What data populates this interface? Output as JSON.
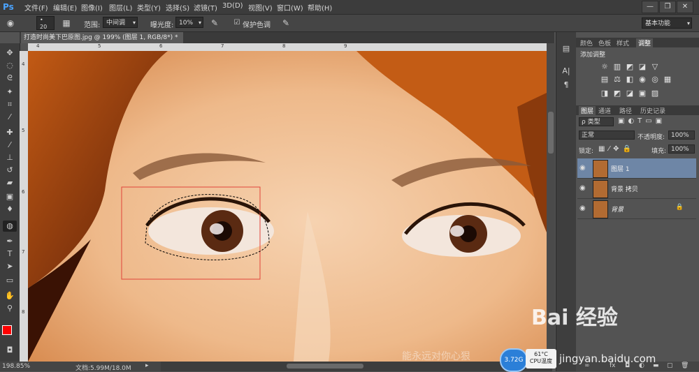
{
  "app": {
    "logo": "Ps"
  },
  "menu": [
    "文件(F)",
    "编辑(E)",
    "图像(I)",
    "图层(L)",
    "类型(Y)",
    "选择(S)",
    "滤镜(T)",
    "3D(D)",
    "视图(V)",
    "窗口(W)",
    "帮助(H)"
  ],
  "window_controls": {
    "minimize": "—",
    "restore": "❐",
    "close": "✕"
  },
  "options": {
    "brush_size": "20",
    "range_label": "范围:",
    "range_value": "中间调",
    "exposure_label": "曝光度:",
    "exposure_value": "10%",
    "protect_label": "保护色调",
    "protect_checked": true,
    "workspace": "基本功能"
  },
  "document": {
    "tab_title": "打造时尚美下巴原图.jpg @ 199% (图层 1, RGB/8*) *",
    "tab_close": "×"
  },
  "rulers": {
    "top_ticks": [
      "4",
      "5",
      "6",
      "7",
      "8",
      "9"
    ],
    "left_ticks": [
      "4",
      "5",
      "6",
      "7",
      "8"
    ]
  },
  "status": {
    "zoom": "198.85%",
    "doc_info": "文档:5.99M/18.0M"
  },
  "adjust_panel": {
    "tabs": [
      "颜色",
      "色板",
      "样式",
      "调整"
    ],
    "active_tab": "调整",
    "title": "添加调整"
  },
  "layers_panel": {
    "tabs": [
      "图层",
      "通道",
      "路径",
      "历史记录"
    ],
    "active_tab": "图层",
    "filter_label": "ρ 类型",
    "blend_mode": "正常",
    "opacity_label": "不透明度:",
    "opacity_value": "100%",
    "lock_label": "锁定:",
    "fill_label": "填充:",
    "fill_value": "100%",
    "layers": [
      {
        "name": "图层 1",
        "selected": true,
        "locked": false
      },
      {
        "name": "背景 拷贝",
        "selected": false,
        "locked": false
      },
      {
        "name": "背景",
        "selected": false,
        "locked": true
      }
    ],
    "footer_icons": [
      "link-icon",
      "fx-icon",
      "mask-icon",
      "adjustment-icon",
      "group-icon",
      "new-layer-icon",
      "trash-icon"
    ]
  },
  "overlays": {
    "cpu_usage": "3.72G",
    "cpu_temp": "61°C",
    "cpu_temp_label": "CPU温度",
    "watermark_text": "能永远对你心狠",
    "baidu_logo": "Bai 经验",
    "baidu_url": "jingyan.baidu.com"
  },
  "colors": {
    "accent": "#4aa3ff",
    "selected_layer": "#6e86a6",
    "foreground": "#ff0000",
    "background": "#ffffff",
    "selection_rect": "#e0443a"
  }
}
